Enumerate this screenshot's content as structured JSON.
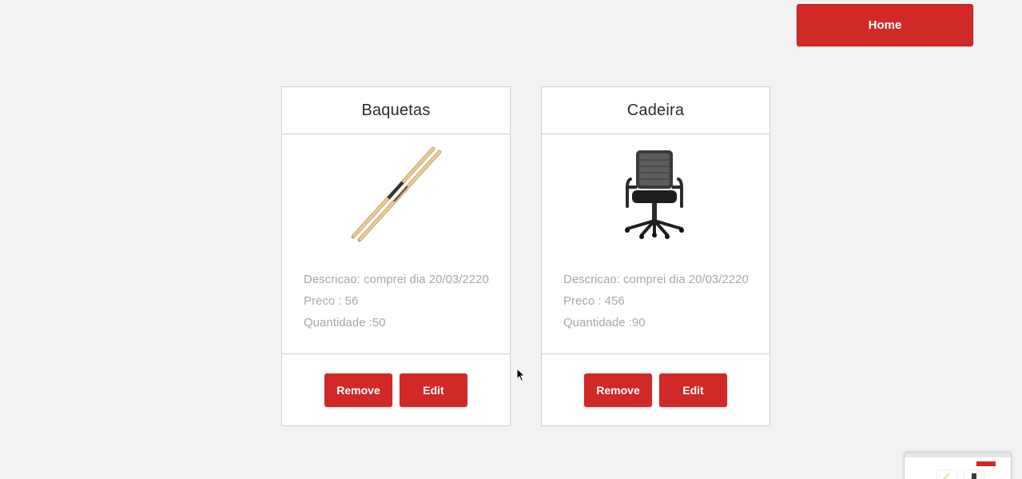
{
  "header": {
    "home_label": "Home"
  },
  "products": [
    {
      "title": "Baquetas",
      "image_icon": "drumsticks-icon",
      "descricao": "Descricao: comprei dia 20/03/2220",
      "preco": "Preco : 56",
      "quantidade": "Quantidade :50",
      "remove_label": "Remove",
      "edit_label": "Edit"
    },
    {
      "title": "Cadeira",
      "image_icon": "office-chair-icon",
      "descricao": "Descricao: comprei dia 20/03/2220",
      "preco": "Preco : 456",
      "quantidade": "Quantidade :90",
      "remove_label": "Remove",
      "edit_label": "Edit"
    }
  ],
  "colors": {
    "accent": "#d12828",
    "background": "#f2f2f2",
    "card_border": "#cfcfcf",
    "muted_text": "#a9a9a9"
  }
}
